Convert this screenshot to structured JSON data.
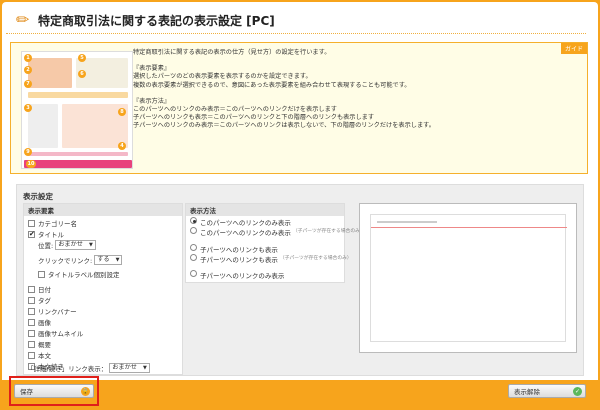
{
  "header": {
    "title": "特定商取引法に関する表記の表示設定 [PC]"
  },
  "guide": {
    "tag": "ガイド",
    "intro": "特定商取引法に関する表記の表示の仕方（見せ方）の設定を行います。",
    "display_elements_heading": "『表示要素』",
    "display_elements_line1": "選択したパーツのどの表示要素を表示するのかを設定できます。",
    "display_elements_line2": "複数の表示要素が選択できるので、意図にあった表示要素を組み合わせて表現することも可能です。",
    "display_method_heading": "『表示方法』",
    "display_method_line1": "このパーツへのリンクのみ表示＝このパーツへのリンクだけを表示します",
    "display_method_line2": "子パーツへのリンクも表示＝このパーツへのリンクと下の階層へのリンクも表示します",
    "display_method_line3": "子パーツへのリンクのみ表示＝このパーツへのリンクは表示しないで、下の階層のリンクだけを表示します。",
    "thumb_numbers": [
      "1",
      "2",
      "5",
      "6",
      "7",
      "3",
      "8",
      "4",
      "9",
      "10"
    ]
  },
  "settings": {
    "title": "表示設定",
    "elements": {
      "heading": "表示要素",
      "category_name": "カテゴリー名",
      "title_item": "タイトル",
      "position_label": "位置:",
      "position_value": "おまかせ",
      "click_link_label": "クリックでリンク:",
      "click_link_value": "する",
      "title_label_setting": "タイトルラベル個別設定",
      "items": [
        "日付",
        "タグ",
        "リンクバナー",
        "画像",
        "画像サムネイル",
        "概要",
        "本文",
        "本文続き"
      ],
      "detail_link_label": "「詳細/続き」リンク表示：",
      "detail_link_value": "おまかせ"
    },
    "method": {
      "heading": "表示方法",
      "option1": "このパーツへのリンクのみ表示",
      "option2": "このパーツへのリンクのみ表示",
      "option2_note": "（子パーツが存在する場合のみ）",
      "option3": "子パーツへのリンクも表示",
      "option4": "子パーツへのリンクも表示",
      "option4_note": "（子パーツが存在する場合のみ）",
      "option5": "子パーツへのリンクのみ表示"
    }
  },
  "footer": {
    "save_label": "保存",
    "hide_label": "表示解除"
  },
  "colors": {
    "accent": "#f7a41c",
    "highlight": "#e0201a"
  }
}
